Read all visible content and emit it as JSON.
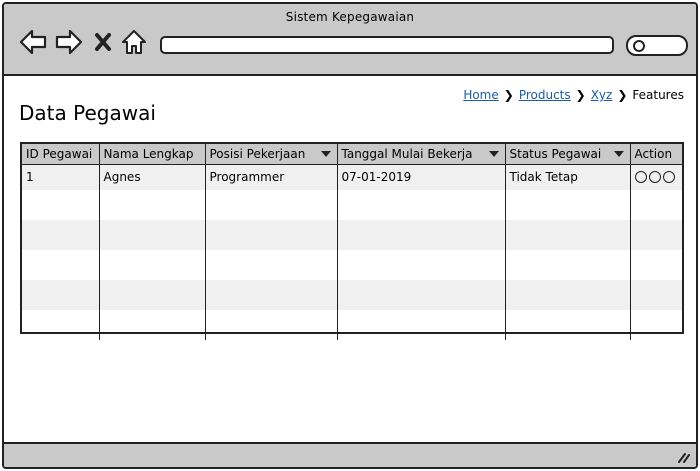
{
  "window": {
    "title": "Sistem Kepegawaian"
  },
  "toolbar": {
    "url_value": ""
  },
  "breadcrumb": [
    "Home",
    "Products",
    "Xyz",
    "Features"
  ],
  "page": {
    "title": "Data Pegawai"
  },
  "table": {
    "headers": [
      "ID Pegawai",
      "Nama Lengkap",
      "Posisi Pekerjaan",
      "Tanggal Mulai Bekerja",
      "Status Pegawai",
      "Action"
    ],
    "rows": [
      [
        "1",
        "Agnes",
        "Programmer",
        "07-01-2019",
        "Tidak Tetap",
        ""
      ],
      [
        "",
        "",
        "",
        "",
        "",
        ""
      ],
      [
        "",
        "",
        "",
        "",
        "",
        ""
      ],
      [
        "",
        "",
        "",
        "",
        "",
        ""
      ],
      [
        "",
        "",
        "",
        "",
        "",
        ""
      ],
      [
        "",
        "",
        "",
        "",
        "",
        ""
      ]
    ]
  }
}
